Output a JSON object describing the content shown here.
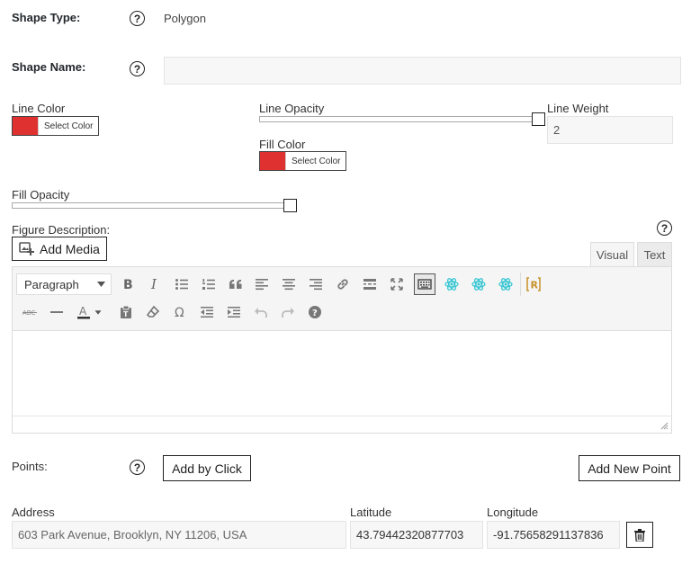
{
  "shape_type": {
    "label": "Shape Type:",
    "value": "Polygon"
  },
  "shape_name": {
    "label": "Shape Name:",
    "value": ""
  },
  "line_color": {
    "label": "Line Color",
    "swatch": "#e03131",
    "button_label": "Select Color"
  },
  "line_opacity": {
    "label": "Line Opacity",
    "level": 1.0
  },
  "line_weight": {
    "label": "Line Weight",
    "value": "2"
  },
  "fill_color": {
    "label": "Fill Color",
    "swatch": "#e03131",
    "button_label": "Select Color"
  },
  "fill_opacity": {
    "label": "Fill Opacity",
    "level": 1.0
  },
  "description": {
    "label": "Figure Description:",
    "add_media_label": "Add Media",
    "tabs": [
      {
        "label": "Visual",
        "active": true
      },
      {
        "label": "Text",
        "active": false
      }
    ],
    "format_select": "Paragraph",
    "content": ""
  },
  "points": {
    "label": "Points:",
    "add_by_click_label": "Add by Click",
    "add_new_point_label": "Add New Point",
    "columns": {
      "address": "Address",
      "latitude": "Latitude",
      "longitude": "Longitude"
    },
    "rows": [
      {
        "address": "603 Park Avenue, Brooklyn, NY 11206, USA",
        "latitude": "43.79442320877703",
        "longitude": "-91.75658291137836"
      }
    ]
  },
  "colors": {
    "accent_red": "#e03131",
    "teal_icon": "#32c5d2",
    "field_bg": "#f7f7f7"
  }
}
